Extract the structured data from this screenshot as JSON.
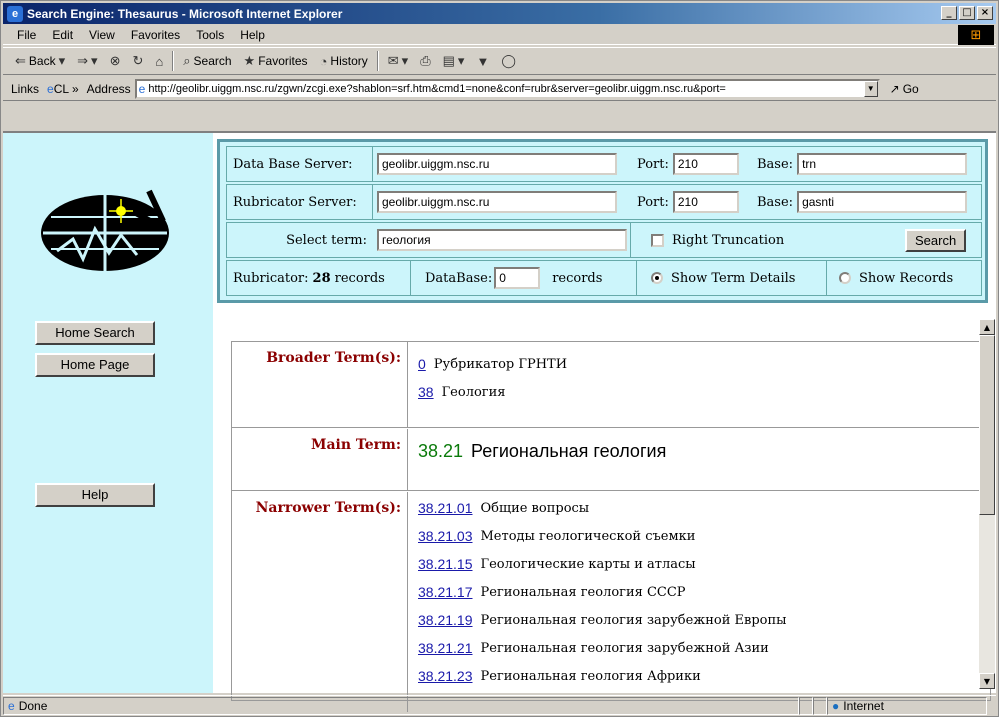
{
  "window": {
    "title": "Search Engine: Thesaurus - Microsoft Internet Explorer"
  },
  "menu": [
    "File",
    "Edit",
    "View",
    "Favorites",
    "Tools",
    "Help"
  ],
  "toolbar": {
    "back": "Back",
    "search": "Search",
    "favorites": "Favorites",
    "history": "History"
  },
  "addressbar": {
    "links_label": "Links",
    "links_item": "CL",
    "address_label": "Address",
    "url": "http://geolibr.uiggm.nsc.ru/zgwn/zcgi.exe?shablon=srf.htm&cmd1=none&conf=rubr&server=geolibr.uiggm.nsc.ru&port=",
    "go": "Go"
  },
  "sidebar": {
    "home_search": "Home Search",
    "home_page": "Home Page",
    "help": "Help"
  },
  "form": {
    "db_server_label": "Data Base Server:",
    "db_server_value": "geolibr.uiggm.nsc.ru",
    "port_label": "Port:",
    "db_port_value": "210",
    "base_label": "Base:",
    "db_base_value": "trn",
    "rub_server_label": "Rubricator Server:",
    "rub_server_value": "geolibr.uiggm.nsc.ru",
    "rub_port_value": "210",
    "rub_base_value": "gasnti",
    "select_term_label": "Select term:",
    "select_term_value": "геология",
    "right_truncation": "Right Truncation",
    "search_button": "Search",
    "rubricator_label": "Rubricator:",
    "rubricator_count": "28",
    "records_word": "records",
    "database_label": "DataBase:",
    "database_value": "0",
    "show_term_details": "Show Term Details",
    "show_records": "Show Records"
  },
  "results": {
    "broader_label": "Broader Term(s):",
    "broader": [
      {
        "code": "0",
        "term": "Рубрикатор ГРНТИ"
      },
      {
        "code": "38",
        "term": "Геология"
      }
    ],
    "main_label": "Main Term:",
    "main_code": "38.21",
    "main_term": "Региональная геология",
    "narrower_label": "Narrower Term(s):",
    "narrower": [
      {
        "code": "38.21.01",
        "term": "Общие вопросы"
      },
      {
        "code": "38.21.03",
        "term": "Методы геологической съемки"
      },
      {
        "code": "38.21.15",
        "term": "Геологические карты и атласы"
      },
      {
        "code": "38.21.17",
        "term": "Региональная геология СССР"
      },
      {
        "code": "38.21.19",
        "term": "Региональная геология зарубежной Европы"
      },
      {
        "code": "38.21.21",
        "term": "Региональная геология зарубежной Азии"
      },
      {
        "code": "38.21.23",
        "term": "Региональная геология Африки"
      }
    ]
  },
  "status": {
    "left": "Done",
    "zone": "Internet"
  }
}
